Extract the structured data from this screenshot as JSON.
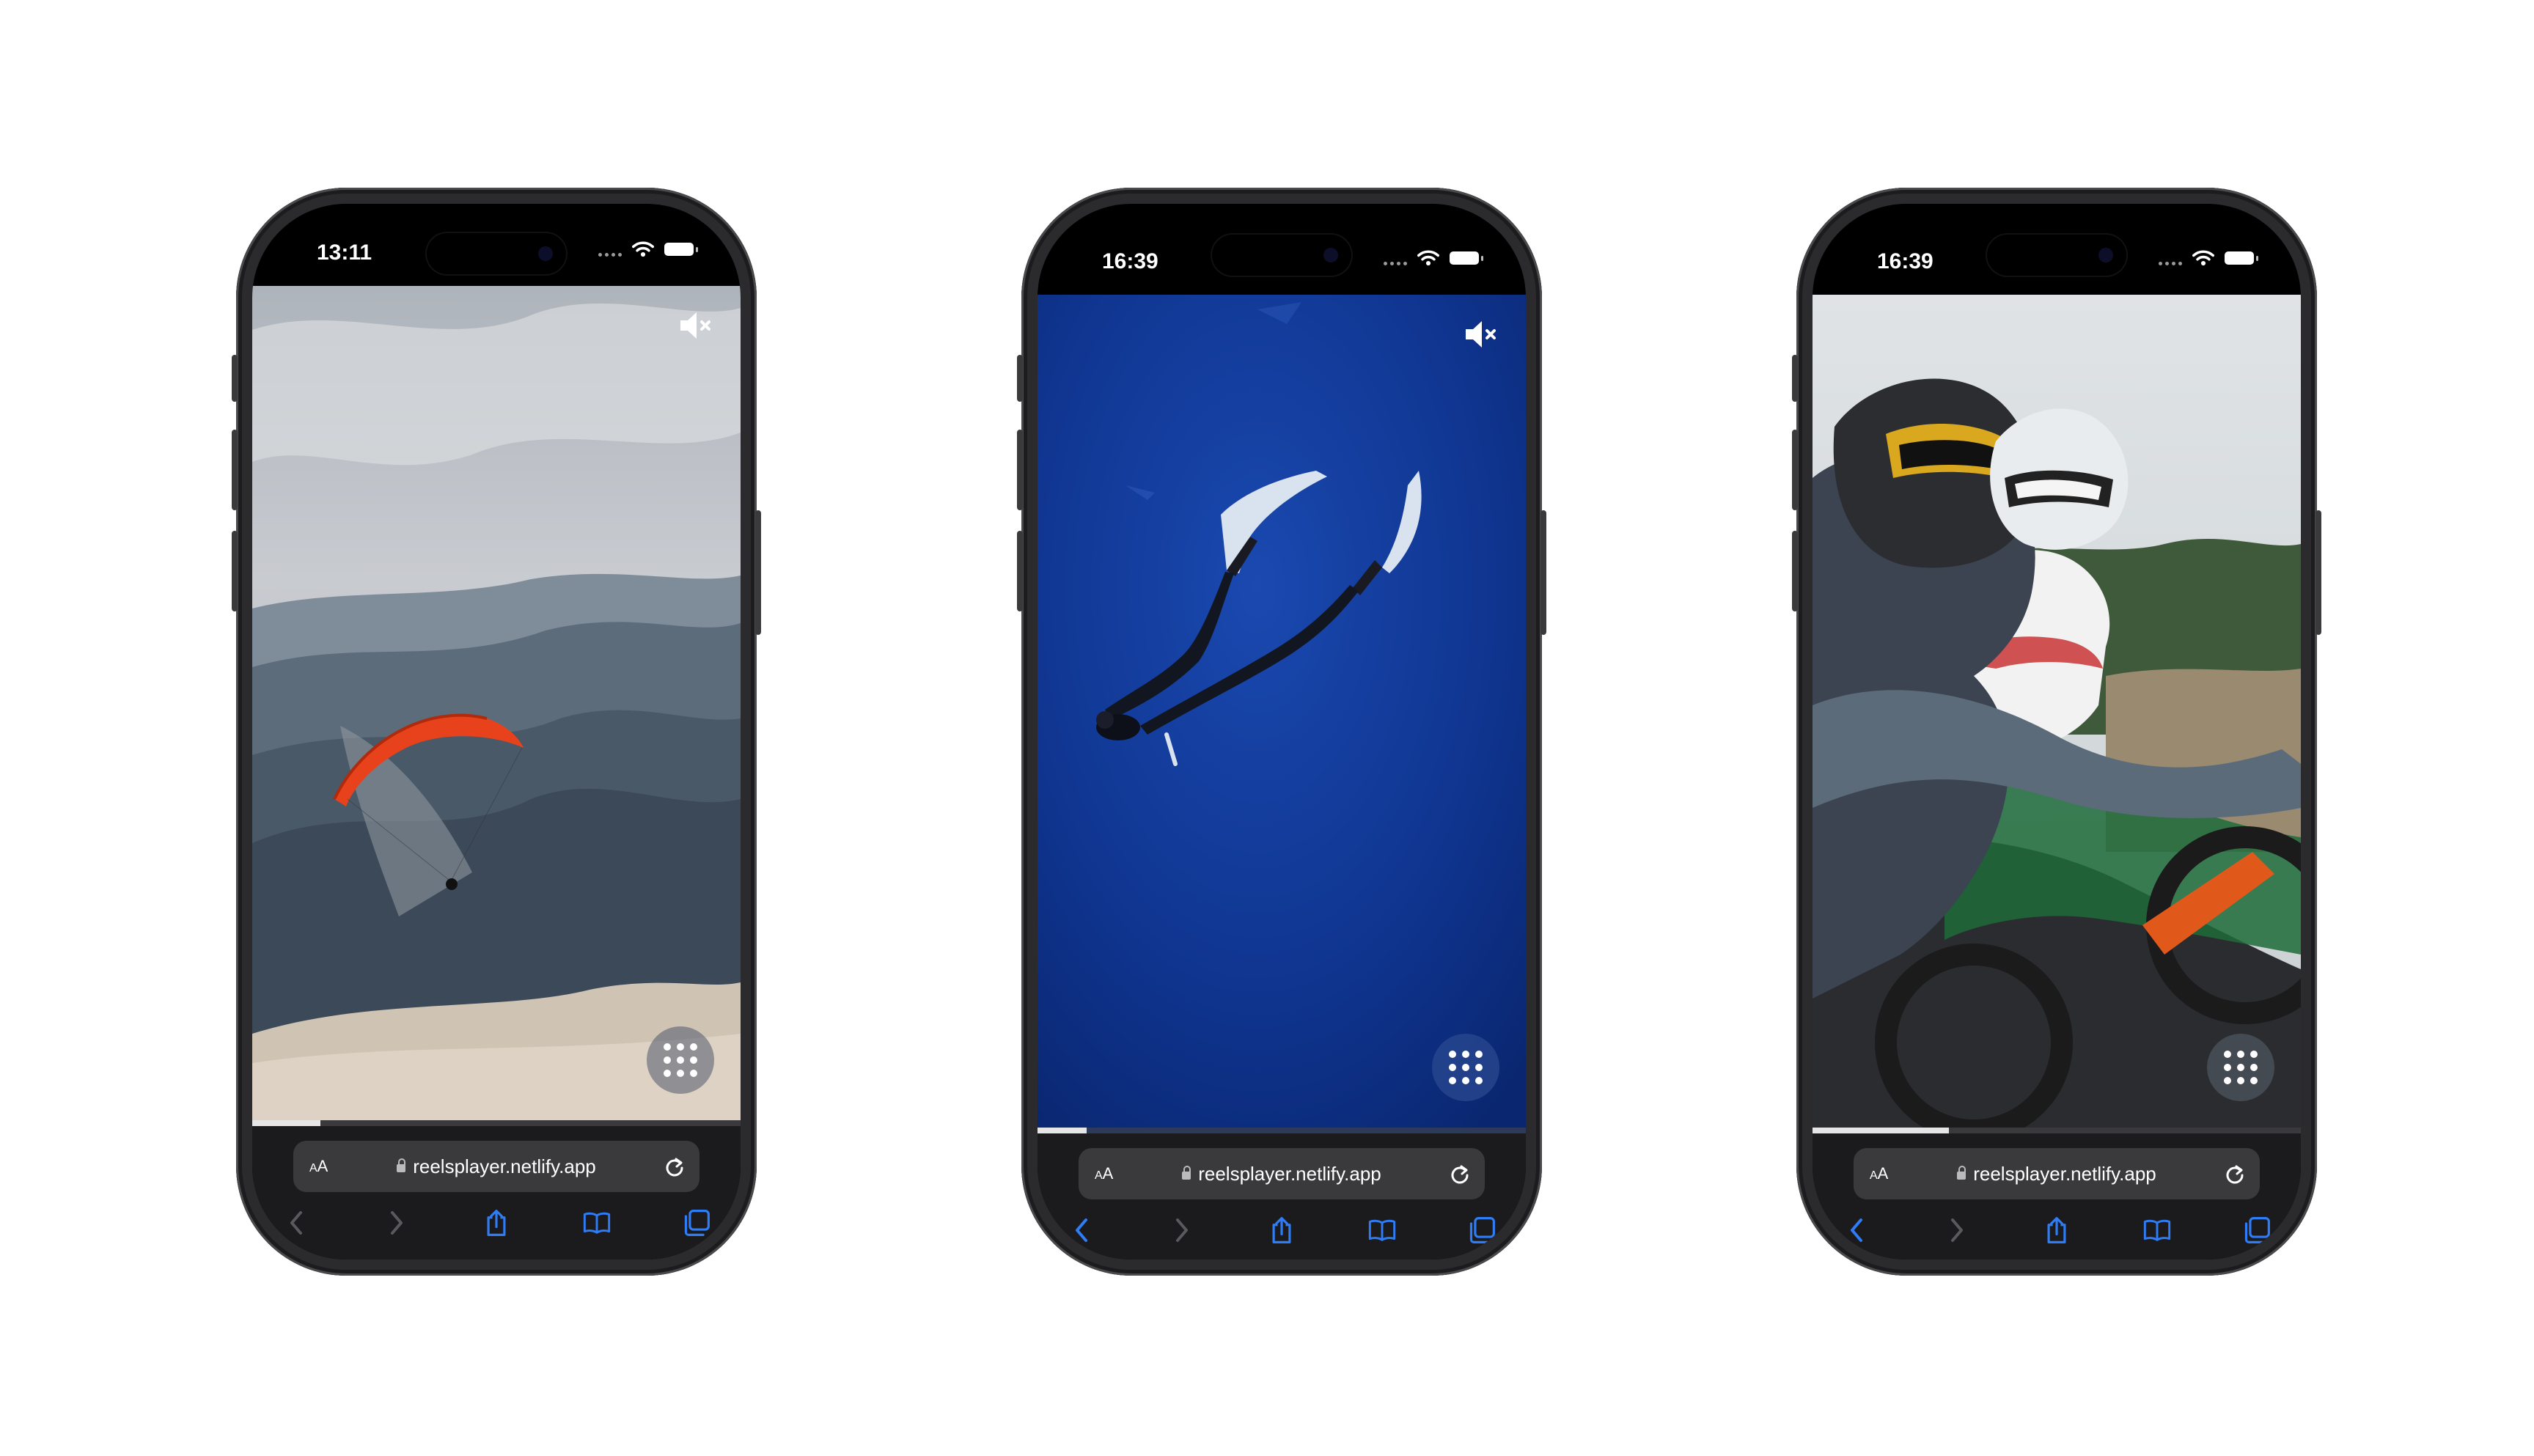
{
  "colors": {
    "background": "#ffffff",
    "accent_blue": "#2f7df6",
    "toolbar": "#1b1b1d",
    "urlbar": "#3a3a3c"
  },
  "phones": [
    {
      "time": "13:11",
      "scene": "paraglider",
      "mute_icon": "speaker-muted-icon",
      "grid_icon": "grid-dots-icon",
      "url": "reelsplayer.netlify.app",
      "text_size_label_small": "A",
      "text_size_label_large": "A",
      "progress": 0.14,
      "back_enabled": false,
      "forward_enabled": false,
      "home_indicator": true
    },
    {
      "time": "16:39",
      "scene": "freediver",
      "mute_icon": "speaker-muted-icon",
      "grid_icon": "grid-dots-icon",
      "url": "reelsplayer.netlify.app",
      "text_size_label_small": "A",
      "text_size_label_large": "A",
      "progress": 0.1,
      "back_enabled": true,
      "forward_enabled": false,
      "home_indicator": false
    },
    {
      "time": "16:39",
      "scene": "motocross riders",
      "mute_icon": "",
      "grid_icon": "grid-dots-icon",
      "url": "reelsplayer.netlify.app",
      "text_size_label_small": "A",
      "text_size_label_large": "A",
      "progress": 0.28,
      "back_enabled": true,
      "forward_enabled": false,
      "home_indicator": false
    }
  ]
}
